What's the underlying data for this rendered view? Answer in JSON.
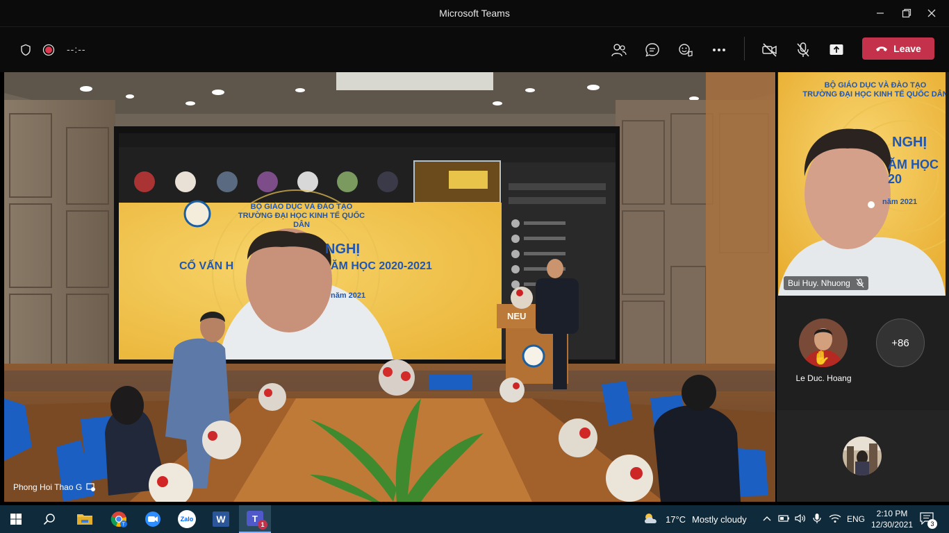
{
  "window": {
    "title": "Microsoft Teams"
  },
  "toolbar": {
    "timer": "--:--",
    "leave_label": "Leave",
    "icons": [
      "shield-icon",
      "record-icon",
      "participants-icon",
      "chat-icon",
      "reactions-icon",
      "more-icon",
      "camera-off-icon",
      "mic-off-icon",
      "share-icon"
    ]
  },
  "stage": {
    "main_participant": "Phong Hoi Thao G",
    "screen_header_line1": "BỘ GIÁO DỤC VÀ ĐÀO TẠO",
    "screen_header_line2": "TRƯỜNG ĐẠI HỌC KINH TẾ QUỐC DÂN",
    "screen_title_a": "NGHỊ",
    "screen_title_b": "CỐ VẤN H",
    "screen_title_c": "ĂM HỌC 2020-2021",
    "screen_date": "năm 2021",
    "podium_text": "NEU"
  },
  "side": {
    "video_participant": "Bui Huy. Nhuong",
    "video_header_line1": "BỘ GIÁO DỤC VÀ ĐÀO TẠO",
    "video_header_line2": "TRƯỜNG ĐẠI HỌC KINH TẾ QUỐC DÂN",
    "video_title_a": "NGHỊ",
    "video_title_b": "ĂM HỌC 20",
    "video_date": "năm 2021",
    "participant_name": "Le Duc. Hoang",
    "overflow_count": "+86"
  },
  "taskbar": {
    "weather_temp": "17°C",
    "weather_desc": "Mostly cloudy",
    "language": "ENG",
    "time": "2:10 PM",
    "date": "12/30/2021",
    "teams_badge": "1",
    "notification_count": "3",
    "zalo_label": "Zalo",
    "word_label": "W",
    "teams_label": "T"
  },
  "colors": {
    "leave": "#c4314b",
    "title_bar": "#0b0b0b",
    "taskbar": "#0f2a3a"
  }
}
